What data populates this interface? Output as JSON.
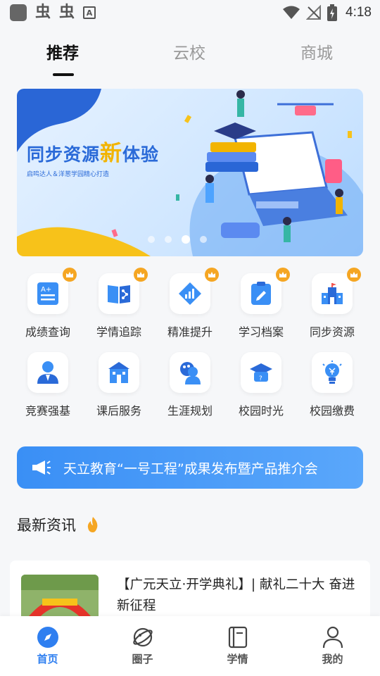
{
  "status_bar": {
    "glyph_1": "虫",
    "glyph_2": "虫",
    "a_icon": "A",
    "time": "4:18",
    "icons": [
      "app-square-icon",
      "bug-icon",
      "bug-icon",
      "keyboard-a-icon",
      "wifi-icon",
      "no-signal-icon",
      "battery-charging-icon"
    ]
  },
  "tabs": [
    {
      "label": "推荐",
      "active": true
    },
    {
      "label": "云校",
      "active": false
    },
    {
      "label": "商城",
      "active": false
    }
  ],
  "banner": {
    "title_part1": "同步资源",
    "title_highlight": "新",
    "title_part2": "体验",
    "subtitle": "启鸣达人＆洋葱学园精心打造",
    "slide_count": 4,
    "active_slide": 3
  },
  "grid": [
    {
      "label": "成绩查询",
      "icon": "grade-report-icon",
      "crown": true
    },
    {
      "label": "学情追踪",
      "icon": "learning-tracking-icon",
      "crown": true
    },
    {
      "label": "精准提升",
      "icon": "precision-improve-icon",
      "crown": true
    },
    {
      "label": "学习档案",
      "icon": "study-file-icon",
      "crown": true
    },
    {
      "label": "同步资源",
      "icon": "school-building-icon",
      "crown": true
    },
    {
      "label": "竞赛强基",
      "icon": "competition-person-icon",
      "crown": false
    },
    {
      "label": "课后服务",
      "icon": "after-school-building-icon",
      "crown": false
    },
    {
      "label": "生涯规划",
      "icon": "career-planning-icon",
      "crown": false
    },
    {
      "label": "校园时光",
      "icon": "graduation-cap-icon",
      "crown": false
    },
    {
      "label": "校园缴费",
      "icon": "campus-payment-bulb-icon",
      "crown": false
    }
  ],
  "notice": {
    "text": "天立教育“一号工程”成果发布暨产品推介会",
    "icon": "megaphone-icon"
  },
  "news": {
    "heading": "最新资讯",
    "heading_icon": "flame-icon",
    "items": [
      {
        "title": "【广元天立·开学典礼】| 献礼二十大 奋进新征程"
      }
    ]
  },
  "bottom_nav": [
    {
      "label": "首页",
      "icon": "compass-icon",
      "active": true
    },
    {
      "label": "圈子",
      "icon": "planet-icon",
      "active": false
    },
    {
      "label": "学情",
      "icon": "book-icon",
      "active": false
    },
    {
      "label": "我的",
      "icon": "profile-icon",
      "active": false
    }
  ],
  "colors": {
    "accent": "#2f7ff0",
    "crown": "#f5a623",
    "notice_bg": "#3a8ff5",
    "banner_highlight": "#f2b400"
  }
}
